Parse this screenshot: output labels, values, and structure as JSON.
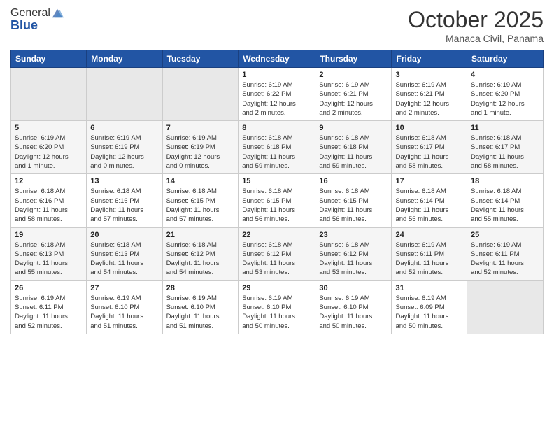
{
  "logo": {
    "line1": "General",
    "line2": "Blue"
  },
  "header": {
    "month": "October 2025",
    "location": "Manaca Civil, Panama"
  },
  "weekdays": [
    "Sunday",
    "Monday",
    "Tuesday",
    "Wednesday",
    "Thursday",
    "Friday",
    "Saturday"
  ],
  "weeks": [
    [
      {
        "day": "",
        "info": ""
      },
      {
        "day": "",
        "info": ""
      },
      {
        "day": "",
        "info": ""
      },
      {
        "day": "1",
        "info": "Sunrise: 6:19 AM\nSunset: 6:22 PM\nDaylight: 12 hours\nand 2 minutes."
      },
      {
        "day": "2",
        "info": "Sunrise: 6:19 AM\nSunset: 6:21 PM\nDaylight: 12 hours\nand 2 minutes."
      },
      {
        "day": "3",
        "info": "Sunrise: 6:19 AM\nSunset: 6:21 PM\nDaylight: 12 hours\nand 2 minutes."
      },
      {
        "day": "4",
        "info": "Sunrise: 6:19 AM\nSunset: 6:20 PM\nDaylight: 12 hours\nand 1 minute."
      }
    ],
    [
      {
        "day": "5",
        "info": "Sunrise: 6:19 AM\nSunset: 6:20 PM\nDaylight: 12 hours\nand 1 minute."
      },
      {
        "day": "6",
        "info": "Sunrise: 6:19 AM\nSunset: 6:19 PM\nDaylight: 12 hours\nand 0 minutes."
      },
      {
        "day": "7",
        "info": "Sunrise: 6:19 AM\nSunset: 6:19 PM\nDaylight: 12 hours\nand 0 minutes."
      },
      {
        "day": "8",
        "info": "Sunrise: 6:18 AM\nSunset: 6:18 PM\nDaylight: 11 hours\nand 59 minutes."
      },
      {
        "day": "9",
        "info": "Sunrise: 6:18 AM\nSunset: 6:18 PM\nDaylight: 11 hours\nand 59 minutes."
      },
      {
        "day": "10",
        "info": "Sunrise: 6:18 AM\nSunset: 6:17 PM\nDaylight: 11 hours\nand 58 minutes."
      },
      {
        "day": "11",
        "info": "Sunrise: 6:18 AM\nSunset: 6:17 PM\nDaylight: 11 hours\nand 58 minutes."
      }
    ],
    [
      {
        "day": "12",
        "info": "Sunrise: 6:18 AM\nSunset: 6:16 PM\nDaylight: 11 hours\nand 58 minutes."
      },
      {
        "day": "13",
        "info": "Sunrise: 6:18 AM\nSunset: 6:16 PM\nDaylight: 11 hours\nand 57 minutes."
      },
      {
        "day": "14",
        "info": "Sunrise: 6:18 AM\nSunset: 6:15 PM\nDaylight: 11 hours\nand 57 minutes."
      },
      {
        "day": "15",
        "info": "Sunrise: 6:18 AM\nSunset: 6:15 PM\nDaylight: 11 hours\nand 56 minutes."
      },
      {
        "day": "16",
        "info": "Sunrise: 6:18 AM\nSunset: 6:15 PM\nDaylight: 11 hours\nand 56 minutes."
      },
      {
        "day": "17",
        "info": "Sunrise: 6:18 AM\nSunset: 6:14 PM\nDaylight: 11 hours\nand 55 minutes."
      },
      {
        "day": "18",
        "info": "Sunrise: 6:18 AM\nSunset: 6:14 PM\nDaylight: 11 hours\nand 55 minutes."
      }
    ],
    [
      {
        "day": "19",
        "info": "Sunrise: 6:18 AM\nSunset: 6:13 PM\nDaylight: 11 hours\nand 55 minutes."
      },
      {
        "day": "20",
        "info": "Sunrise: 6:18 AM\nSunset: 6:13 PM\nDaylight: 11 hours\nand 54 minutes."
      },
      {
        "day": "21",
        "info": "Sunrise: 6:18 AM\nSunset: 6:12 PM\nDaylight: 11 hours\nand 54 minutes."
      },
      {
        "day": "22",
        "info": "Sunrise: 6:18 AM\nSunset: 6:12 PM\nDaylight: 11 hours\nand 53 minutes."
      },
      {
        "day": "23",
        "info": "Sunrise: 6:18 AM\nSunset: 6:12 PM\nDaylight: 11 hours\nand 53 minutes."
      },
      {
        "day": "24",
        "info": "Sunrise: 6:19 AM\nSunset: 6:11 PM\nDaylight: 11 hours\nand 52 minutes."
      },
      {
        "day": "25",
        "info": "Sunrise: 6:19 AM\nSunset: 6:11 PM\nDaylight: 11 hours\nand 52 minutes."
      }
    ],
    [
      {
        "day": "26",
        "info": "Sunrise: 6:19 AM\nSunset: 6:11 PM\nDaylight: 11 hours\nand 52 minutes."
      },
      {
        "day": "27",
        "info": "Sunrise: 6:19 AM\nSunset: 6:10 PM\nDaylight: 11 hours\nand 51 minutes."
      },
      {
        "day": "28",
        "info": "Sunrise: 6:19 AM\nSunset: 6:10 PM\nDaylight: 11 hours\nand 51 minutes."
      },
      {
        "day": "29",
        "info": "Sunrise: 6:19 AM\nSunset: 6:10 PM\nDaylight: 11 hours\nand 50 minutes."
      },
      {
        "day": "30",
        "info": "Sunrise: 6:19 AM\nSunset: 6:10 PM\nDaylight: 11 hours\nand 50 minutes."
      },
      {
        "day": "31",
        "info": "Sunrise: 6:19 AM\nSunset: 6:09 PM\nDaylight: 11 hours\nand 50 minutes."
      },
      {
        "day": "",
        "info": ""
      }
    ]
  ]
}
